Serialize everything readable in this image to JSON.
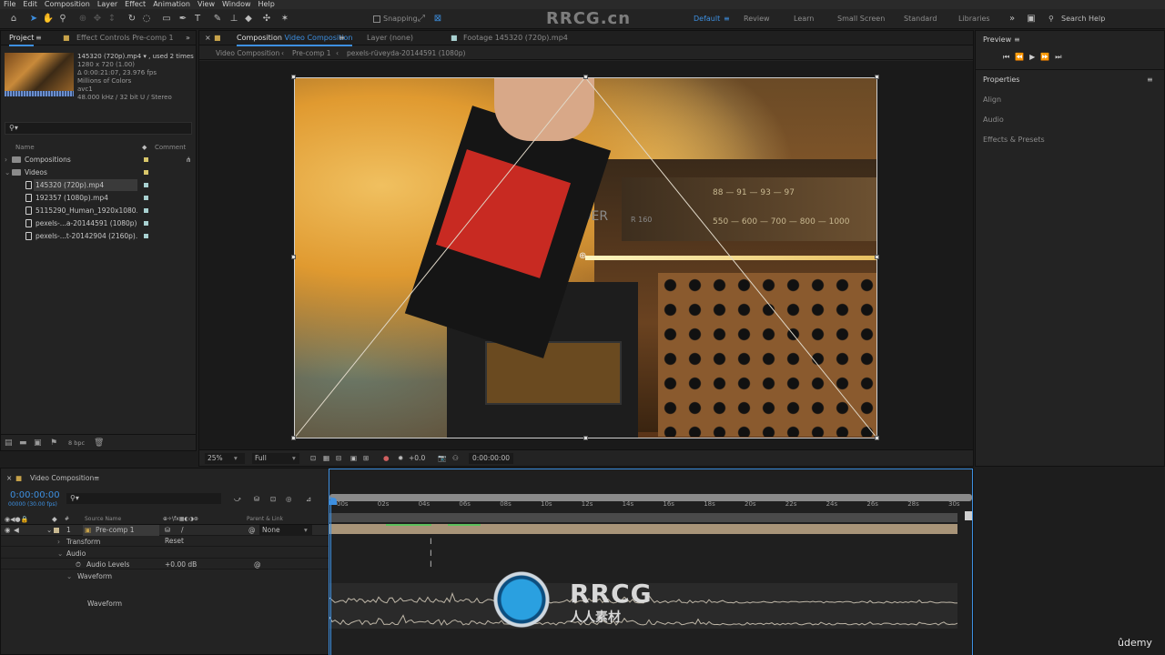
{
  "menu": [
    "File",
    "Edit",
    "Composition",
    "Layer",
    "Effect",
    "Animation",
    "View",
    "Window",
    "Help"
  ],
  "toolbar": {
    "snapping": "Snapping",
    "workspaces": [
      "Default",
      "Review",
      "Learn",
      "Small Screen",
      "Standard",
      "Libraries"
    ],
    "active_workspace": "Default",
    "search_help": "Search Help"
  },
  "watermark": "RRCG.cn",
  "project": {
    "tab_project": "Project",
    "tab_effects": "Effect Controls Pre-comp 1",
    "file_name": "145320 (720p).mp4 ▾ , used 2 times",
    "info_lines": [
      "1280 x 720 (1.00)",
      "Δ 0:00:21:07, 23.976 fps",
      "Millions of Colors",
      "avc1",
      "48.000 kHz / 32 bit U / Stereo"
    ],
    "search_placeholder": "",
    "col_name": "Name",
    "col_comment": "Comment",
    "items": [
      {
        "name": "Compositions",
        "type": "folder",
        "label_color": "#d8c66a"
      },
      {
        "name": "Videos",
        "type": "folder",
        "label_color": "#d8c66a"
      },
      {
        "name": "145320 (720p).mp4",
        "type": "file",
        "label_color": "#a8d0d0",
        "selected": true
      },
      {
        "name": "192357 (1080p).mp4",
        "type": "file",
        "label_color": "#a8d0d0"
      },
      {
        "name": "5115290_Human_1920x1080.mp4",
        "type": "file",
        "label_color": "#a8d0d0"
      },
      {
        "name": "pexels-...a-20144591 (1080p).mp4",
        "type": "file",
        "label_color": "#a8d0d0"
      },
      {
        "name": "pexels-...t-20142904 (2160p).mp4",
        "type": "file",
        "label_color": "#a8d0d0"
      }
    ],
    "bpc": "8 bpc"
  },
  "viewer": {
    "tab_comp_prefix": "Composition",
    "tab_comp_name": "Video Composition",
    "tab_layer": "Layer (none)",
    "tab_footage": "Footage 145320 (720p).mp4",
    "breadcrumbs": [
      "Video Composition",
      "Pre-comp 1",
      "pexels-rüveyda-20144591 (1080p)"
    ],
    "zoom": "25%",
    "resolution": "Full",
    "exposure": "+0.0",
    "timecode": "0:00:00:00",
    "frame_text": [
      "RDER",
      "R 160",
      "550 — 600 — 700 — 800 — 1000",
      "88 — 91 — 93 — 97"
    ]
  },
  "right": {
    "preview": "Preview",
    "properties": "Properties",
    "items": [
      "Align",
      "Audio",
      "Effects & Presets"
    ]
  },
  "timeline": {
    "tab": "Video Composition",
    "timecode": "0:00:00:00",
    "fps_note": "00000 (30.00 fps)",
    "col_source": "Source Name",
    "col_parent": "Parent & Link",
    "layer_num": "1",
    "layer_name": "Pre-comp 1",
    "parent_value": "None",
    "props": [
      {
        "label": "Transform",
        "value": "Reset",
        "indent": 1
      },
      {
        "label": "Audio",
        "value": "",
        "indent": 1
      },
      {
        "label": "Audio Levels",
        "value": "+0.00 dB",
        "indent": 2
      },
      {
        "label": "Waveform",
        "value": "",
        "indent": 2
      },
      {
        "label": "Waveform",
        "value": "",
        "indent": 3
      }
    ],
    "ticks": [
      "00s",
      "02s",
      "04s",
      "06s",
      "08s",
      "10s",
      "12s",
      "14s",
      "16s",
      "18s",
      "20s",
      "22s",
      "24s",
      "26s",
      "28s",
      "30s"
    ]
  },
  "logo": {
    "top": "RRCG",
    "bottom": "人人素材"
  },
  "udemy": "ûdemy",
  "colors": {
    "accent": "#3d8fe0",
    "panel": "#232323",
    "bg": "#1d1d1d"
  }
}
